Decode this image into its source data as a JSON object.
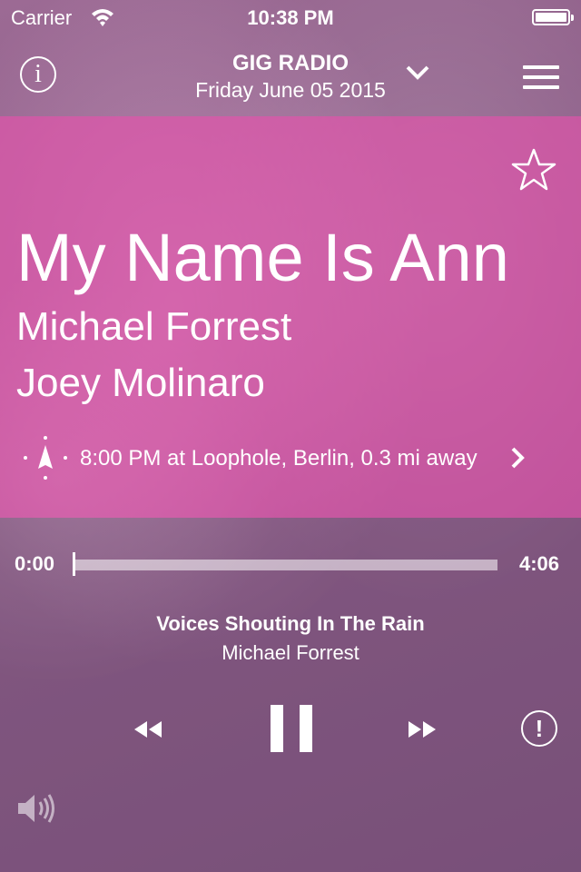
{
  "status_bar": {
    "carrier": "Carrier",
    "time": "10:38 PM"
  },
  "nav": {
    "station_name": "GIG RADIO",
    "date": "Friday June 05 2015",
    "info_icon": "i"
  },
  "song": {
    "title": "My Name Is Ann",
    "artist": "Michael Forrest",
    "secondary_artist": "Joey Molinaro",
    "gig_info": "8:00 PM at Loophole, Berlin, 0.3 mi away"
  },
  "player": {
    "elapsed": "0:00",
    "total": "4:06",
    "progress": 0.0,
    "now_playing_title": "Voices Shouting In The Rain",
    "now_playing_artist": "Michael Forrest",
    "report_icon": "!"
  },
  "icons": {
    "wifi": "wifi-icon",
    "battery": "battery-icon",
    "info": "info-icon",
    "chevron": "chevron-down-icon",
    "menu": "hamburger-menu-icon",
    "star": "star-icon",
    "location": "location-icon",
    "arrow": "chevron-right-icon",
    "rewind": "rewind-icon",
    "pause": "pause-icon",
    "ffwd": "fast-forward-icon",
    "report": "report-icon",
    "volume": "volume-icon"
  },
  "colors": {
    "hero_overlay": "#e850ac",
    "accent": "#ffffff"
  }
}
